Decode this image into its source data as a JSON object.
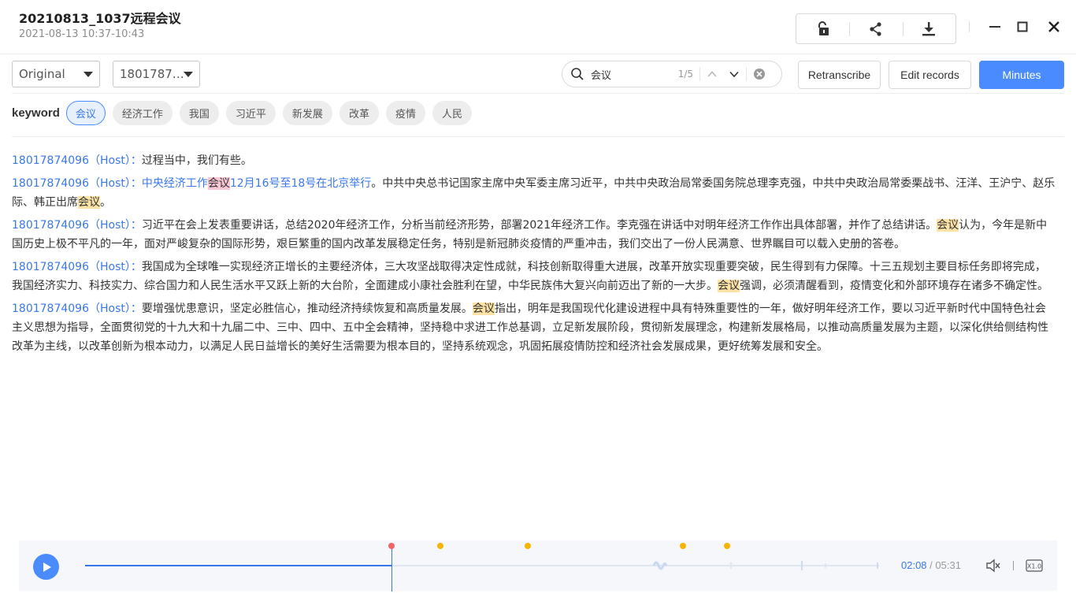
{
  "header": {
    "title": "20210813_1037远程会议",
    "datetime": "2021-08-13 10:37-10:43",
    "tools": [
      {
        "icon": "unlock-icon"
      },
      {
        "icon": "share-icon"
      },
      {
        "icon": "download-icon"
      }
    ],
    "window": {
      "minimize": "minimize-icon",
      "maximize": "maximize-icon",
      "close": "close-icon"
    }
  },
  "toolbar": {
    "view_select": "Original",
    "speaker_select": "1801787…",
    "search": {
      "value": "会议",
      "count": "1/5"
    },
    "retranscribe": "Retranscribe",
    "edit_records": "Edit records",
    "minutes": "Minutes"
  },
  "keywords": {
    "label": "keyword",
    "items": [
      "会议",
      "经济工作",
      "我国",
      "习近平",
      "新发展",
      "改革",
      "疫情",
      "人民"
    ],
    "active_index": 0
  },
  "transcript": [
    {
      "speaker": "18017874096（Host）：",
      "segments": [
        {
          "t": "过程当中，我们有些。",
          "s": ""
        }
      ]
    },
    {
      "speaker": "18017874096（Host）：",
      "segments": [
        {
          "t": "中央经济工作",
          "s": "blue"
        },
        {
          "t": "会议",
          "s": "hl-cur"
        },
        {
          "t": "12月16号至18号在北京举行",
          "s": "blue"
        },
        {
          "t": "。中共中央总书记国家主席中央军委主席习近平，中共中央政治局常委国务院总理李克强，中共中央政治局常委栗战书、汪洋、王沪宁、赵乐际、韩正出席",
          "s": ""
        },
        {
          "t": "会议",
          "s": "hl"
        },
        {
          "t": "。",
          "s": ""
        }
      ]
    },
    {
      "speaker": "18017874096（Host）：",
      "segments": [
        {
          "t": "习近平在会上发表重要讲话，总结2020年经济工作，分析当前经济形势，部署2021年经济工作。李克强在讲话中对明年经济工作作出具体部署，并作了总结讲话。",
          "s": ""
        },
        {
          "t": "会议",
          "s": "hl"
        },
        {
          "t": "认为，今年是新中国历史上极不平凡的一年，面对严峻复杂的国际形势，艰巨繁重的国内改革发展稳定任务，特别是新冠肺炎疫情的严重冲击，我们交出了一份人民满意、世界瞩目可以载入史册的答卷。",
          "s": ""
        }
      ]
    },
    {
      "speaker": "18017874096（Host）：",
      "segments": [
        {
          "t": "我国成为全球唯一实现经济正增长的主要经济体，三大攻坚战取得决定性成就，科技创新取得重大进展，改革开放实现重要突破，民生得到有力保障。十三五规划主要目标任务即将完成，我国经济实力、科技实力、综合国力和人民生活水平又跃上新的大台阶，全面建成小康社会胜利在望，中华民族伟大复兴向前迈出了新的一大步。",
          "s": ""
        },
        {
          "t": "会议",
          "s": "hl"
        },
        {
          "t": "强调，必须清醒看到，疫情变化和外部环境存在诸多不确定性。",
          "s": ""
        }
      ]
    },
    {
      "speaker": "18017874096（Host）：",
      "segments": [
        {
          "t": "要增强忧患意识，坚定必胜信心，推动经济持续恢复和高质量发展。",
          "s": ""
        },
        {
          "t": "会议",
          "s": "hl"
        },
        {
          "t": "指出，明年是我国现代化建设进程中具有特殊重要性的一年，做好明年经济工作，要以习近平新时代中国特色社会主义思想为指导，全面贯彻党的十九大和十九届二中、三中、四中、五中全会精神，坚持稳中求进工作总基调，立足新发展阶段，贯彻新发展理念，构建新发展格局，以推动高质量发展为主题，以深化供给侧结构性改革为主线，以改革创新为根本动力，以满足人民日益增长的美好生活需要为根本目的，坚持系统观念，巩固拓展疫情防控和经济社会发展成果，更好统筹发展和安全。",
          "s": ""
        }
      ]
    }
  ],
  "player": {
    "current": "02:08",
    "total": "05:31",
    "progress": 0.386,
    "keyword_markers": [
      0.447,
      0.558,
      0.753,
      0.809
    ],
    "speed": "X1.0"
  }
}
